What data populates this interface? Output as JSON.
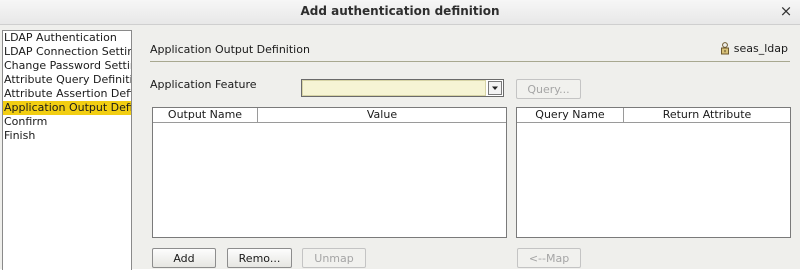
{
  "window": {
    "title": "Add authentication definition",
    "close_glyph": "×"
  },
  "wizard_steps": [
    {
      "label": "LDAP Authentication",
      "selected": false
    },
    {
      "label": "LDAP Connection Setting",
      "selected": false
    },
    {
      "label": "Change Password Settin",
      "selected": false
    },
    {
      "label": "Attribute Query Definitior",
      "selected": false
    },
    {
      "label": "Attribute Assertion Defin",
      "selected": false
    },
    {
      "label": "Application Output Defin",
      "selected": true
    },
    {
      "label": "Confirm",
      "selected": false
    },
    {
      "label": "Finish",
      "selected": false
    }
  ],
  "section": {
    "title": "Application Output Definition",
    "user_icon": "user-lock-icon",
    "user_label": "seas_ldap"
  },
  "feature": {
    "label": "Application Feature",
    "selected_value": "",
    "query_button": "Query..."
  },
  "output_table": {
    "columns": [
      "Output Name",
      "Value"
    ],
    "rows": []
  },
  "query_table": {
    "columns": [
      "Query Name",
      "Return Attribute"
    ],
    "rows": []
  },
  "buttons": {
    "add": "Add",
    "remove": "Remo...",
    "unmap": "Unmap",
    "map": "<--Map"
  },
  "colors": {
    "selection": "#f2ce12",
    "panel_bg": "#efefec"
  }
}
